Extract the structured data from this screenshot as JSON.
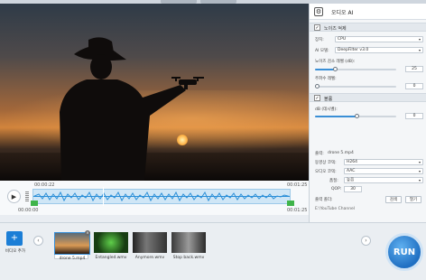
{
  "panel": {
    "title": "오디오 AI",
    "section_noise": "노이즈 억제",
    "device_label": "장치:",
    "device_value": "CPU",
    "model_label": "AI 모델:",
    "model_value": "DeepFilter v3.0",
    "strength_label": "노이즈 감소 레벨 (dB):",
    "strength_value": "25",
    "threshold_label": "주파수 레벨:",
    "threshold_value": "0",
    "section_volume": "볼륨",
    "volume_label": "dB (데시벨):",
    "volume_value": "0",
    "output_label": "출력:",
    "output_file": "drone 5.mp4",
    "codec_label": "동영상 코덱:",
    "codec_value": "H264",
    "audio_codec_label": "오디오 코덱:",
    "audio_codec_value": "AAC",
    "quality_label": "품질:",
    "quality_value": "높음",
    "bitrate_label": "QOP:",
    "bitrate_value": "30",
    "folder_label": "출력 폴더:",
    "browse_label": "검색",
    "open_label": "열기",
    "folder_path": "E:\\YouTube Channel"
  },
  "timeline": {
    "time_start": "00:00:22",
    "time_end": "00:01:25",
    "time_left": "00:00:00",
    "time_right": "00:01:25"
  },
  "bottom": {
    "add_video_label": "비디오 추가",
    "run_label": "RUN",
    "thumbnails": [
      {
        "name": "drone 5.mp4"
      },
      {
        "name": "Entangled.wmv"
      },
      {
        "name": "Anymore.wmv"
      },
      {
        "name": "Stop back.wmv"
      }
    ]
  },
  "colors": {
    "accent": "#1f6fc2",
    "waveform": "#2b8fd8",
    "handle": "#3fb44a"
  }
}
